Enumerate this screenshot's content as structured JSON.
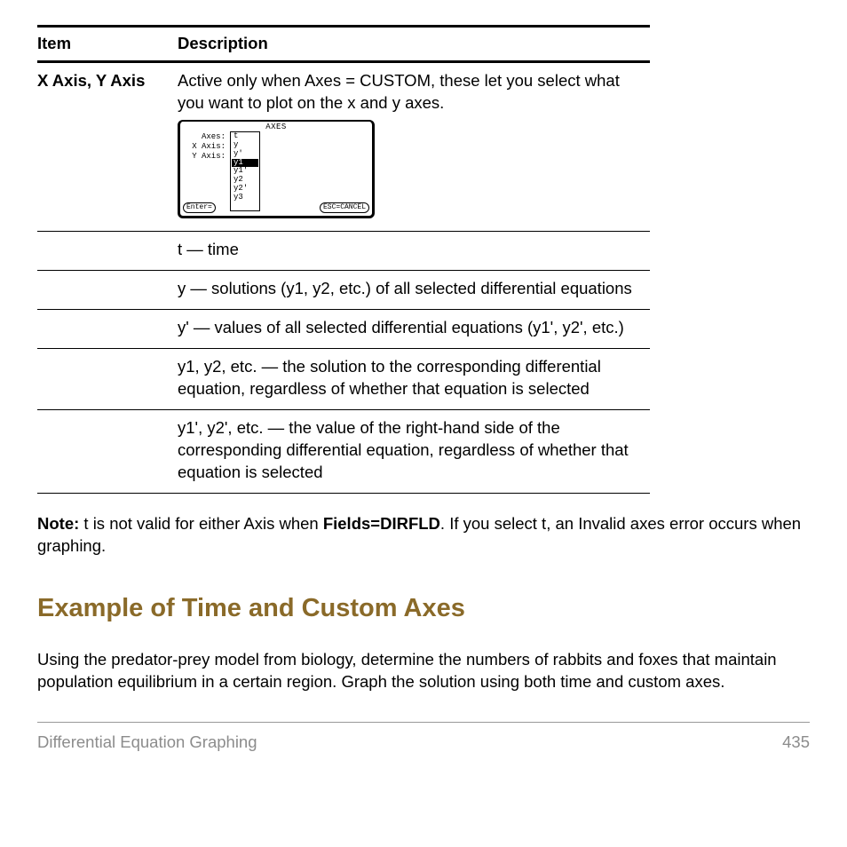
{
  "table": {
    "headers": {
      "item": "Item",
      "desc": "Description"
    },
    "itemLabel": "X Axis, Y Axis",
    "mainDesc": "Active only when Axes = CUSTOM, these let you select what you want to plot on the x and y axes.",
    "rows": [
      "t — time",
      "y — solutions (y1, y2, etc.) of all selected differential equations",
      "y' — values of all selected differential equations (y1', y2', etc.)",
      "y1, y2, etc. — the solution to the corresponding differential equation, regardless of whether that equation is selected",
      "y1', y2', etc. — the value of the right-hand side of the corresponding differential equation, regardless of whether that equation is selected"
    ]
  },
  "calc": {
    "title": "AXES",
    "labels": {
      "axes": "Axes:",
      "xaxis": "X Axis:",
      "yaxis": "Y Axis:"
    },
    "options": [
      "t",
      "y",
      "y'",
      "y1",
      "y1'",
      "y2",
      "y2'",
      "y3"
    ],
    "enter": "Enter=",
    "esc": "ESC=CANCEL"
  },
  "note": {
    "label": "Note:",
    "pre": " t is not valid for either Axis when ",
    "field": "Fields=DIRFLD",
    "post": ". If you select t, an Invalid axes error occurs when graphing."
  },
  "heading": "Example of Time and Custom Axes",
  "body": "Using the predator-prey model from biology, determine the numbers of rabbits and foxes that maintain population equilibrium in a certain region. Graph the solution using both time and custom axes.",
  "footer": {
    "left": "Differential Equation Graphing",
    "right": "435"
  }
}
